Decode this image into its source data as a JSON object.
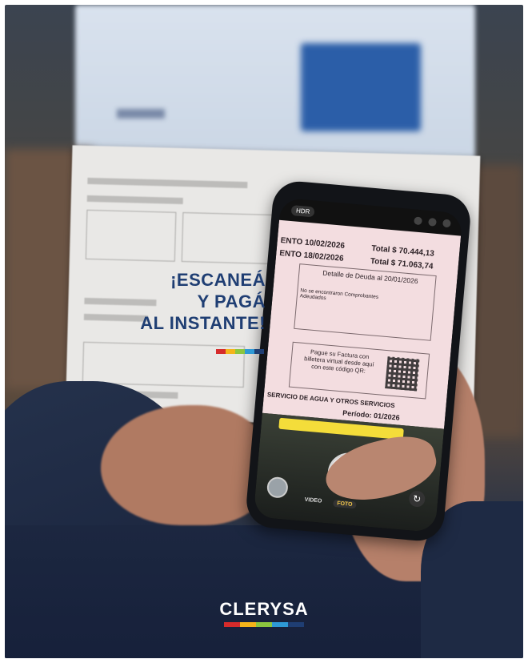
{
  "headline": {
    "line1": "¡ESCANEÁ",
    "line2": "Y PAGÁ",
    "line3": "AL INSTANTE!"
  },
  "brand": {
    "name": "CLERYSA",
    "stripe_colors": [
      "#d62b2b",
      "#f4b41a",
      "#8cc63f",
      "#2e9ad6",
      "#1f3e73"
    ],
    "headline_color": "#1f3e73"
  },
  "phone": {
    "hdr_label": "HDR",
    "bill": {
      "line_due1": "ENTO 10/02/2026",
      "total1": "Total $ 70.444,13",
      "line_due2": "ENTO 18/02/2026",
      "total2": "Total $ 71.063,74",
      "detail_title": "Detalle de Deuda al 20/01/2026",
      "no_records": "No se encontraron Comprobantes Adeudados",
      "pay_text": "Pague su Factura con billetera virtual desde aquí con este código QR:",
      "service": "SERVICIO DE AGUA Y OTROS SERVICIOS",
      "period": "Período: 01/2026"
    },
    "modes": [
      "VIDEO",
      "FOTO"
    ],
    "active_mode": "FOTO"
  }
}
